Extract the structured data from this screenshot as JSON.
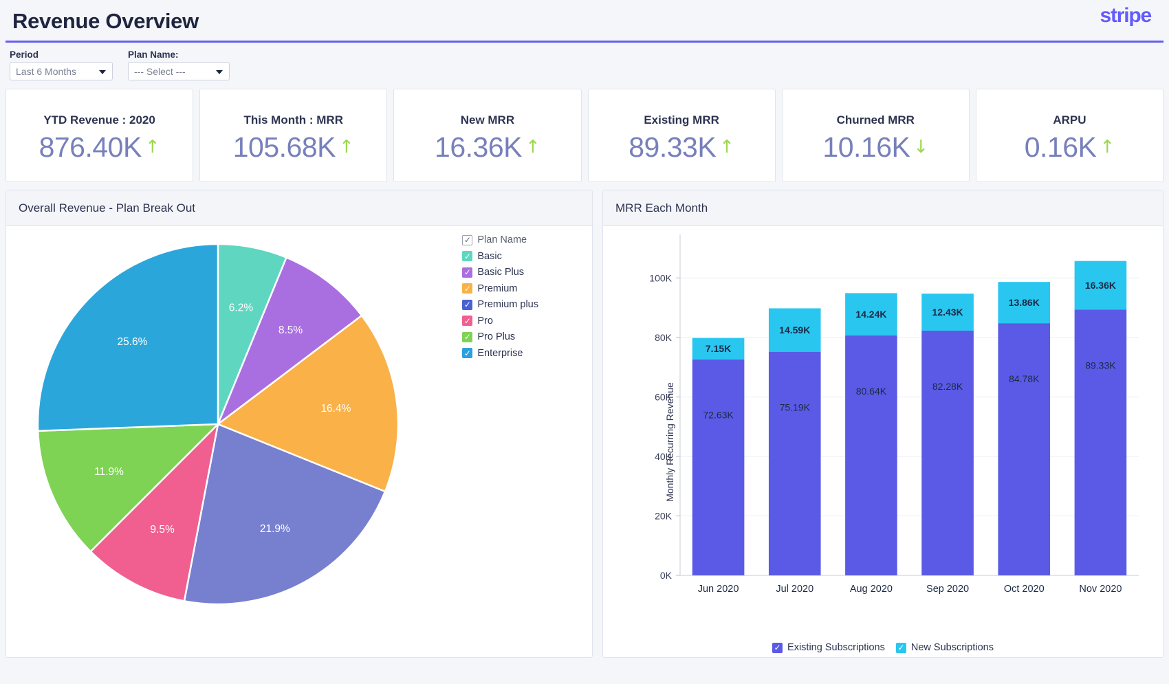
{
  "header": {
    "title": "Revenue Overview",
    "brand": "stripe"
  },
  "filters": [
    {
      "label": "Period",
      "value": "Last 6 Months",
      "icon": "chevron-down-icon"
    },
    {
      "label": "Plan Name:",
      "value": "--- Select ---",
      "icon": "chevron-down-icon"
    }
  ],
  "kpis": [
    {
      "title": "YTD Revenue : 2020",
      "value": "876.40K",
      "arrow": "↑",
      "direction": "up"
    },
    {
      "title": "This Month : MRR",
      "value": "105.68K",
      "arrow": "↑",
      "direction": "up"
    },
    {
      "title": "New MRR",
      "value": "16.36K",
      "arrow": "↑",
      "direction": "up"
    },
    {
      "title": "Existing MRR",
      "value": "89.33K",
      "arrow": "↑",
      "direction": "up"
    },
    {
      "title": "Churned MRR",
      "value": "10.16K",
      "arrow": "↓",
      "direction": "down"
    },
    {
      "title": "ARPU",
      "value": "0.16K",
      "arrow": "↑",
      "direction": "up"
    }
  ],
  "panels": {
    "left_title": "Overall Revenue - Plan Break Out",
    "right_title": "MRR Each Month"
  },
  "pie_legend_header": "Plan Name",
  "bar_legend": [
    {
      "label": "Existing Subscriptions",
      "color": "#5a5ae6"
    },
    {
      "label": "New Subscriptions",
      "color": "#29c6f0"
    }
  ],
  "colors": {
    "accent": "#675dec",
    "brand": "#635bff",
    "kpi_value": "#7780bb",
    "arrow_up": "#9ad84f",
    "arrow_down": "#9ad84f",
    "title": "#1f2540"
  },
  "chart_data": [
    {
      "type": "pie",
      "title": "Overall Revenue - Plan Break Out",
      "legend_position": "right",
      "legend_title": "Plan Name",
      "categories": [
        "Basic",
        "Basic Plus",
        "Premium",
        "Premium plus",
        "Pro",
        "Pro Plus",
        "Enterprise"
      ],
      "values": [
        6.2,
        8.5,
        16.4,
        21.9,
        9.5,
        11.9,
        25.6
      ],
      "value_labels": [
        "6.2%",
        "8.5%",
        "16.4%",
        "21.9%",
        "9.5%",
        "11.9%",
        "25.6%"
      ],
      "colors": [
        "#5fd6c0",
        "#a96fe0",
        "#f9b148",
        "#7780cf",
        "#f05f8f",
        "#7ed254",
        "#2ba6db"
      ],
      "unit": "%"
    },
    {
      "type": "bar",
      "subtype": "stacked",
      "title": "MRR Each Month",
      "xlabel": "",
      "ylabel": "Monthly Recurring Revenue",
      "categories": [
        "Jun 2020",
        "Jul 2020",
        "Aug 2020",
        "Sep 2020",
        "Oct 2020",
        "Nov 2020"
      ],
      "ylim": [
        0,
        110000
      ],
      "yticks": [
        0,
        20000,
        40000,
        60000,
        80000,
        100000
      ],
      "ytick_labels": [
        "0K",
        "20K",
        "40K",
        "60K",
        "80K",
        "100K"
      ],
      "grid": true,
      "legend_position": "bottom",
      "series": [
        {
          "name": "Existing Subscriptions",
          "color": "#5a5ae6",
          "values": [
            72630,
            75190,
            80640,
            82280,
            84780,
            89330
          ],
          "labels": [
            "72.63K",
            "75.19K",
            "80.64K",
            "82.28K",
            "84.78K",
            "89.33K"
          ]
        },
        {
          "name": "New Subscriptions",
          "color": "#29c6f0",
          "values": [
            7150,
            14590,
            14240,
            12430,
            13860,
            16360
          ],
          "labels": [
            "7.15K",
            "14.59K",
            "14.24K",
            "12.43K",
            "13.86K",
            "16.36K"
          ]
        }
      ]
    }
  ],
  "pie_legend_items": [
    {
      "label": "Basic",
      "color": "#5fd6c0",
      "checked": true
    },
    {
      "label": "Basic Plus",
      "color": "#a96fe0",
      "checked": true
    },
    {
      "label": "Premium",
      "color": "#f9b148",
      "checked": true
    },
    {
      "label": "Premium plus",
      "color": "#4a5fd0",
      "checked": true
    },
    {
      "label": "Pro",
      "color": "#f05f8f",
      "checked": true
    },
    {
      "label": "Pro Plus",
      "color": "#7ed254",
      "checked": true
    },
    {
      "label": "Enterprise",
      "color": "#2b9fe0",
      "checked": true
    }
  ]
}
